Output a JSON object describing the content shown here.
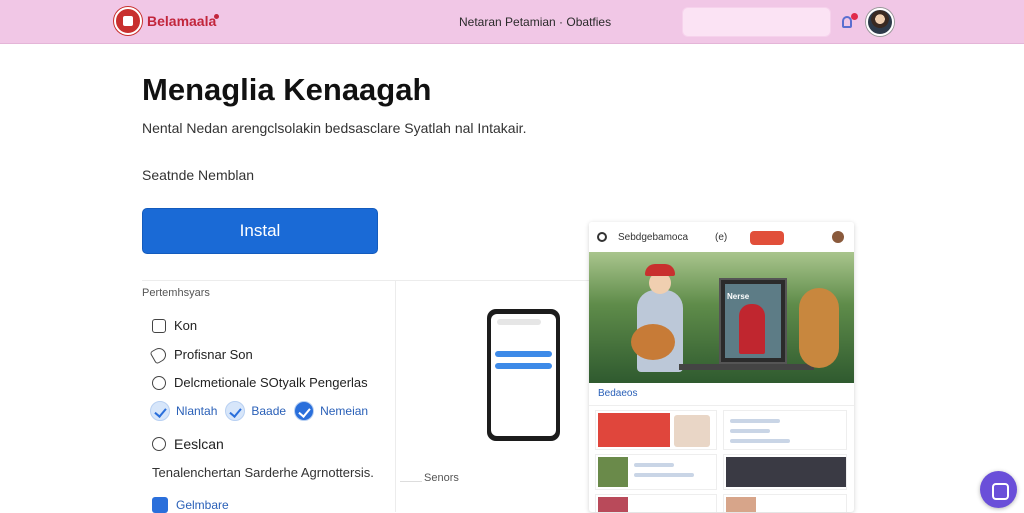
{
  "header": {
    "brand": "Belamaala",
    "nav_text": "Netaran Petamian  ·  Obatfies",
    "search_placeholder": ""
  },
  "app": {
    "title": "Menaglia Kenaagah",
    "subtitle": "Nental Nedan arengclsolakin bedsasclare Syatlah nal Intakair.",
    "developer": "Seatnde Nemblan",
    "install_label": "Instal"
  },
  "permissions": {
    "title": "Pertemhsyars",
    "items": [
      {
        "label": "Kon",
        "icon": "message-icon"
      },
      {
        "label": "Profisnar Son",
        "icon": "tag-icon"
      },
      {
        "label": "Delcmetionale SOtyalk Pengerlas",
        "icon": "chat-icon"
      }
    ],
    "chips": [
      "Nlantah",
      "Baade",
      "Nemeian"
    ]
  },
  "section": {
    "title": "Eeslcan",
    "description": "Tenalenchertan Sarderhe Agrnottersis.",
    "footer_link": "Gelmbare",
    "side_title": "Senors"
  },
  "preview": {
    "app_name": "Sebdgebamoca",
    "header_mid": "(e)",
    "hero_caption": "Nerse",
    "section_title": "Bedaeos"
  },
  "colors": {
    "topbar": "#f1c7e6",
    "brand": "#c2263c",
    "install_button": "#1a6ad6",
    "fab": "#6a4fd9"
  }
}
